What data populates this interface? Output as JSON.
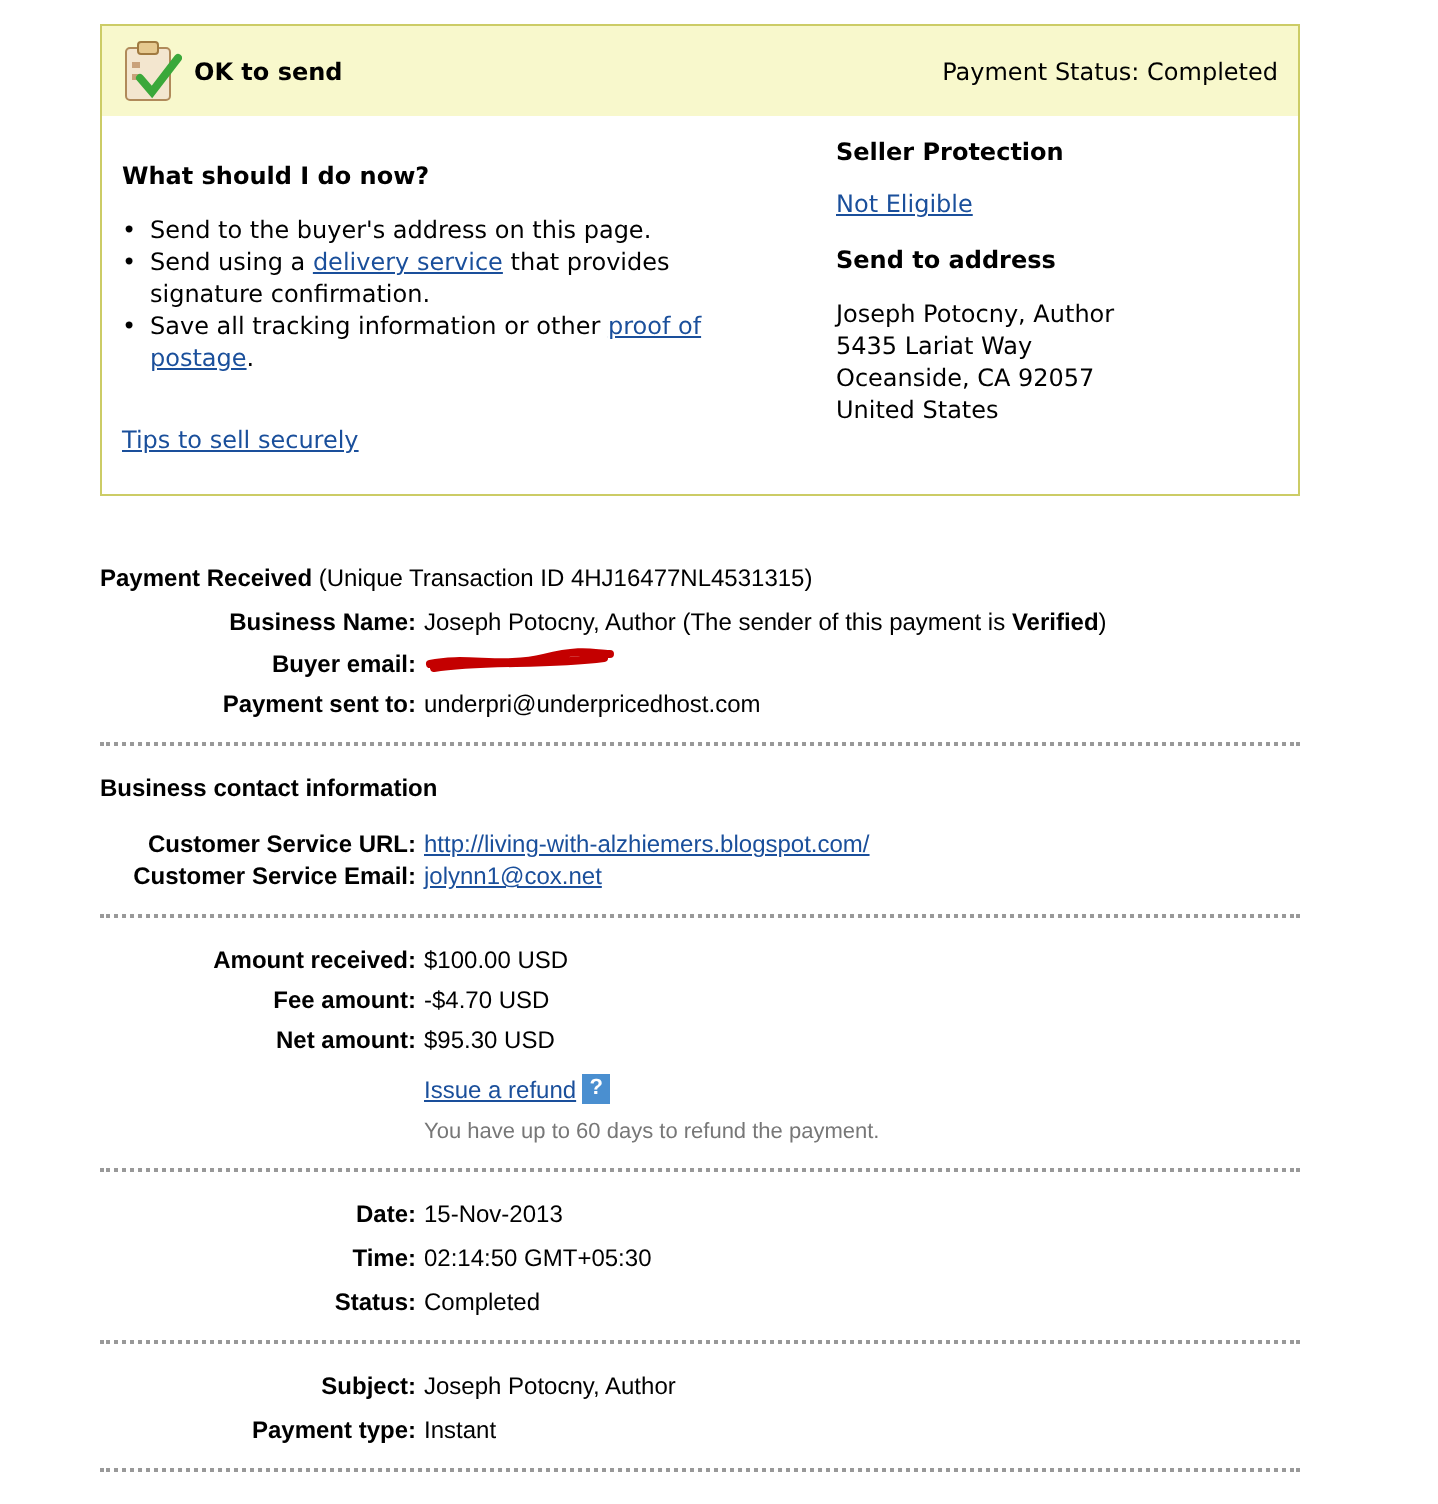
{
  "notice": {
    "title": "OK to send",
    "status": "Payment Status: Completed",
    "heading": "What should I do now?",
    "steps": [
      {
        "marker": "•",
        "parts": [
          {
            "kind": "text",
            "text": "Send to the buyer's address on this page."
          }
        ]
      },
      {
        "marker": "•",
        "parts": [
          {
            "kind": "text",
            "text": "Send using a "
          },
          {
            "kind": "link",
            "text": "delivery service"
          },
          {
            "kind": "text",
            "text": " that provides signature confirmation."
          }
        ]
      },
      {
        "marker": "•",
        "parts": [
          {
            "kind": "text",
            "text": "Save all tracking information or other "
          },
          {
            "kind": "link",
            "text": "proof of"
          },
          {
            "kind": "link",
            "text": "postage"
          },
          {
            "kind": "text",
            "text": "."
          }
        ]
      }
    ],
    "tips_link": "Tips to sell securely",
    "seller_protection": {
      "heading": "Seller Protection",
      "value": "Not Eligible"
    },
    "address": {
      "heading": "Send to address",
      "lines": [
        "Joseph Potocny, Author",
        "5435 Lariat Way",
        "Oceanside, CA 92057",
        "United States"
      ]
    }
  },
  "payment": {
    "title": "Payment Received",
    "transaction": "(Unique Transaction ID 4HJ16477NL4531315)",
    "rows": [
      {
        "label": "Business Name:",
        "kind": "text",
        "value": "Joseph Potocny, Author (The sender of this payment is **Verified**)"
      },
      {
        "label": "Buyer email:",
        "kind": "redacted"
      },
      {
        "label": "Payment sent to:",
        "kind": "text",
        "value": "underpri@underpricedhost.com"
      }
    ]
  },
  "contact": {
    "title": "Business contact information",
    "rows": [
      {
        "label": "Customer Service URL:",
        "kind": "link",
        "value": "http://living-with-alzhiemers.blogspot.com/"
      },
      {
        "label": "Customer Service Email:",
        "kind": "link",
        "value": "jolynn1@cox.net"
      }
    ]
  },
  "amounts": {
    "rows": [
      {
        "label": "Amount received:",
        "kind": "text",
        "value": "$100.00 USD"
      },
      {
        "label": "Fee amount:",
        "kind": "text",
        "value": "-$4.70 USD"
      },
      {
        "label": "Net amount:",
        "kind": "text",
        "value": "$95.30 USD"
      }
    ],
    "refund_link": "Issue a refund",
    "help": "?",
    "refund_note": "You have up to 60 days to refund the payment."
  },
  "details": {
    "rows": [
      {
        "label": "Date:",
        "kind": "text",
        "value": "15-Nov-2013"
      },
      {
        "label": "Time:",
        "kind": "text",
        "value": "02:14:50 GMT+05:30"
      },
      {
        "label": "Status:",
        "kind": "text",
        "value": "Completed"
      }
    ]
  },
  "extra": {
    "rows": [
      {
        "label": "Subject:",
        "kind": "text",
        "value": "Joseph Potocny, Author"
      },
      {
        "label": "Payment type:",
        "kind": "text",
        "value": "Instant"
      }
    ]
  }
}
